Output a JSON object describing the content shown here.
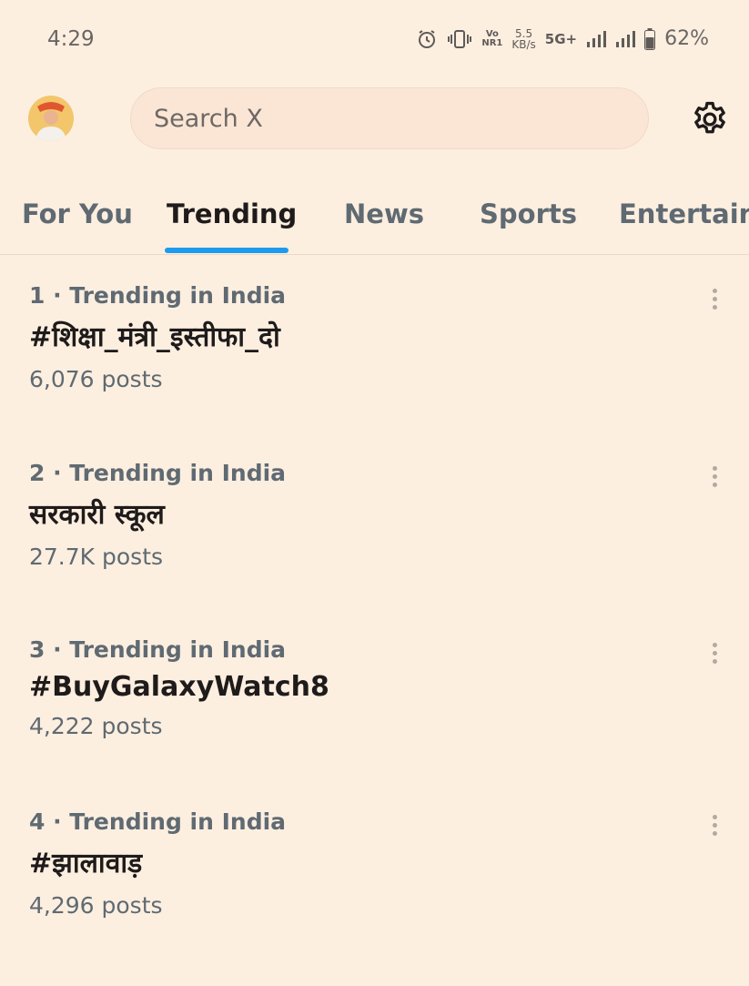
{
  "status_bar": {
    "time": "4:29",
    "network_speed_value": "5.5",
    "network_speed_unit": "KB/s",
    "vo_top": "Vo",
    "vo_bottom": "NR1",
    "net_type": "5G+",
    "battery": "62%",
    "icons": [
      "alarm-icon",
      "vibrate-icon",
      "volte-icon",
      "network-speed",
      "5g-plus-icon",
      "signal-icon",
      "signal-icon",
      "battery-icon"
    ]
  },
  "header": {
    "search_placeholder": "Search X",
    "avatar_icon": "profile-avatar",
    "settings_icon": "gear-icon"
  },
  "tabs": [
    {
      "label": "For You",
      "active": false
    },
    {
      "label": "Trending",
      "active": true
    },
    {
      "label": "News",
      "active": false
    },
    {
      "label": "Sports",
      "active": false
    },
    {
      "label": "Entertain",
      "active": false
    }
  ],
  "trends": [
    {
      "meta": "1 · Trending in India",
      "name": "#शिक्षा_मंत्री_इस्तीफा_दो",
      "count": "6,076 posts"
    },
    {
      "meta": "2 · Trending in India",
      "name": "सरकारी स्कूल",
      "count": "27.7K posts"
    },
    {
      "meta": "3 · Trending in India",
      "name": "#BuyGalaxyWatch8",
      "count": "4,222 posts"
    },
    {
      "meta": "4 · Trending in India",
      "name": "#झालावाड़",
      "count": "4,296 posts"
    }
  ],
  "colors": {
    "background": "#fdefe0",
    "accent": "#1d9bf0",
    "secondary_text": "#5f6a72",
    "primary_text": "#1f1b1b"
  }
}
